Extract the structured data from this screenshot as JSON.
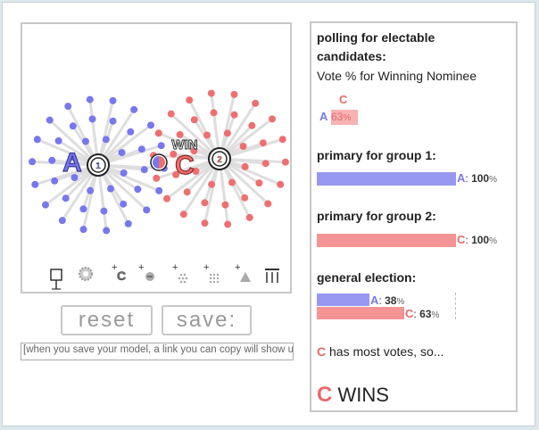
{
  "sim": {
    "candidate_a": "A",
    "candidate_c": "C",
    "marker_1": "1",
    "marker_2": "2",
    "win_label": "WIN",
    "blue_color": "#7777ee",
    "red_color": "#ee6f6f",
    "toolbar_icons": [
      "voter-icon",
      "gear-icon",
      "add-candidate-icon",
      "add-voter-group-icon",
      "add-dots-icon",
      "add-grid-icon",
      "add-triangle-icon",
      "columns-icon"
    ],
    "add_candidate_letter": "C"
  },
  "controls": {
    "reset_label": "reset",
    "save_label": "save:",
    "link_placeholder": "[when you save your model, a link you can copy will show up here]"
  },
  "panel": {
    "polling_title": "polling for electable candidates:",
    "polling_subtitle": "Vote % for Winning Nominee",
    "polling_top_letter": "C",
    "polling_a_letter": "A",
    "polling_value": "63",
    "polling_unit": "%",
    "primary1_title": "primary for group 1:",
    "primary1_letter": "A",
    "primary1_value": "100",
    "primary1_fraction": 1.0,
    "primary2_title": "primary for group 2:",
    "primary2_letter": "C",
    "primary2_value": "100",
    "primary2_fraction": 1.0,
    "general_title": "general election:",
    "general_a_letter": "A",
    "general_a_value": "38",
    "general_a_fraction": 0.38,
    "general_c_letter": "C",
    "general_c_value": "63",
    "general_c_fraction": 0.63,
    "unit": "%",
    "colon": ":",
    "most_votes_letter": "C",
    "most_votes_text": "has most votes, so...",
    "winner_letter": "C",
    "winner_text": "WINS"
  }
}
